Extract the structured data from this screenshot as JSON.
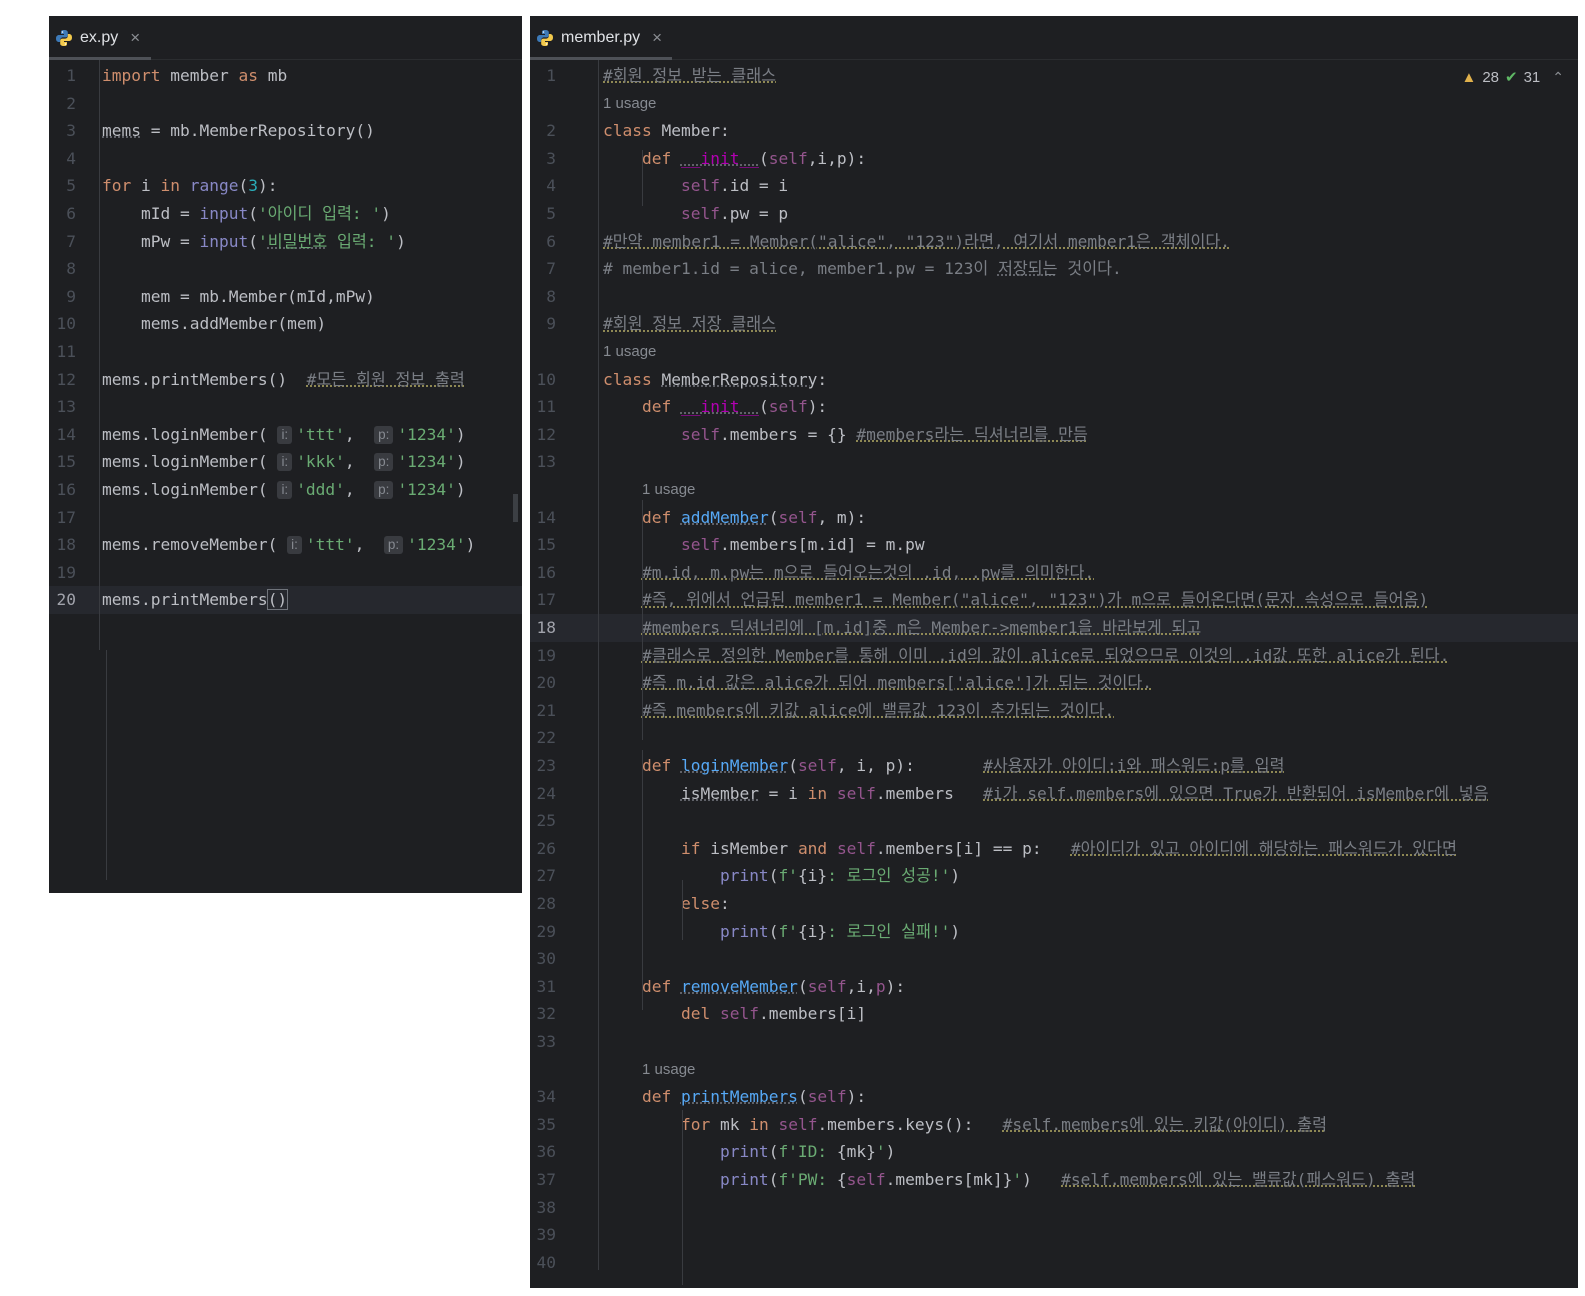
{
  "left_tab": {
    "label": "ex.py",
    "close": "×"
  },
  "right_tab": {
    "label": "member.py",
    "close": "×"
  },
  "inspection": {
    "warnings": "28",
    "ok": "31"
  },
  "usage_label": "1 usage",
  "left_code": [
    {
      "n": "1",
      "html": "<span class='kw'>import</span> member <span class='kw'>as</span> mb"
    },
    {
      "n": "2",
      "html": ""
    },
    {
      "n": "3",
      "html": "<span class='ul'>mems</span> = mb.MemberRepository()"
    },
    {
      "n": "4",
      "html": ""
    },
    {
      "n": "5",
      "html": "<span class='kw'>for</span> i <span class='kw'>in</span> <span class='bi'>range</span>(<span class='num'>3</span>):"
    },
    {
      "n": "6",
      "html": "    mId = <span class='bi'>input</span>(<span class='str'>'아이디 입력: '</span>)"
    },
    {
      "n": "7",
      "html": "    mPw = <span class='bi'>input</span>(<span class='str'>'<span class=\"ul\">비밀번호</span> 입력: '</span>)"
    },
    {
      "n": "8",
      "html": ""
    },
    {
      "n": "9",
      "html": "    mem = mb.Member(mId,mPw)"
    },
    {
      "n": "10",
      "html": "    mems.addMember(mem)"
    },
    {
      "n": "11",
      "html": ""
    },
    {
      "n": "12",
      "html": "mems.printMembers()  <span class='cm'>#모든 회원 정보 출력</span>"
    },
    {
      "n": "13",
      "html": ""
    },
    {
      "n": "14",
      "html": "mems.loginMember( <span class='hint'>i:</span><span class='str'>'ttt'</span>,  <span class='hint'>p:</span><span class='str'>'1234'</span>)"
    },
    {
      "n": "15",
      "html": "mems.loginMember( <span class='hint'>i:</span><span class='str'>'kkk'</span>,  <span class='hint'>p:</span><span class='str'>'1234'</span>)"
    },
    {
      "n": "16",
      "html": "mems.loginMember( <span class='hint'>i:</span><span class='str'>'ddd'</span>,  <span class='hint'>p:</span><span class='str'>'1234'</span>)"
    },
    {
      "n": "17",
      "html": ""
    },
    {
      "n": "18",
      "html": "mems.removeMember( <span class='hint'>i:</span><span class='str'>'ttt'</span>,  <span class='hint'>p:</span><span class='str'>'1234'</span>)"
    },
    {
      "n": "19",
      "html": ""
    },
    {
      "n": "20",
      "html": "mems.printMembers<span class='caret-sel'>()</span>",
      "current": true
    }
  ],
  "right_code": [
    {
      "n": "1",
      "html": "<span class='cm'>#회원 정보 받는 클래스</span>"
    },
    {
      "usage": true,
      "indent": 0
    },
    {
      "n": "2",
      "html": "<span class='kw'>class</span> Member:"
    },
    {
      "n": "3",
      "html": "    <span class='kw'>def</span> <span class='mn ul'>__init__</span>(<span class='slf'>self</span>,i,p):"
    },
    {
      "n": "4",
      "html": "        <span class='slf'>self</span>.id = i"
    },
    {
      "n": "5",
      "html": "        <span class='slf'>self</span>.pw = p"
    },
    {
      "n": "6",
      "html": "<span class='cm'>#만약 member1 = Member(\"alice\", \"123\")라면, 여기서 member1은 객체이다.</span>"
    },
    {
      "n": "7",
      "html": "<span style='color:#7a7e85'># member1.id = alice, member1.pw = 123이 <span class='ul'>저장되는</span> 것이다.</span>"
    },
    {
      "n": "8",
      "html": ""
    },
    {
      "n": "9",
      "html": "<span class='cm'>#회원 정보 저장 클래스</span>"
    },
    {
      "usage": true,
      "indent": 0
    },
    {
      "n": "10",
      "html": "<span class='kw'>class</span> <span class='ul'>MemberRepository</span>:"
    },
    {
      "n": "11",
      "html": "    <span class='kw'>def</span> <span class='mn ul'>__init__</span>(<span class='slf'>self</span>):"
    },
    {
      "n": "12",
      "html": "        <span class='slf'>self</span>.members = {} <span class='cm'>#members라는 딕셔너리를 만듬</span>"
    },
    {
      "n": "13",
      "html": ""
    },
    {
      "usage": true,
      "indent": 4
    },
    {
      "n": "14",
      "html": "    <span class='kw'>def</span> <span class='fn'>addMember</span>(<span class='slf'>self</span>, m):"
    },
    {
      "n": "15",
      "html": "        <span class='slf'>self</span>.members[m.id] = m.pw"
    },
    {
      "n": "16",
      "html": "    <span class='cm'>#m.id, m.pw는 m으로 들어오는것의 .id, .pw를 의미한다.</span>"
    },
    {
      "n": "17",
      "html": "    <span class='cm'>#즉, 위에서 언급된 member1 = Member(\"alice\", \"123\")가 m으로 들어온다면(문자 속성으로 들어옴)</span>"
    },
    {
      "n": "18",
      "html": "    <span class='cm'>#members 딕셔너리에 [m.id]중 m은 Member->member1을 바라보게 되고</span>",
      "current": true
    },
    {
      "n": "19",
      "html": "    <span class='cm'>#클래스로 정의한 Member를 통해 이미 .id의 값이 alice로 되었으므로 이것의 .id값 또한 alice가 된다.</span>"
    },
    {
      "n": "20",
      "html": "    <span class='cm'>#즉 m.id 값은 alice가 되어 members['alice']가 되는 것이다.</span>"
    },
    {
      "n": "21",
      "html": "    <span class='cm'>#즉 members에 키값 alice에 밸류값 123이 추가되는 것이다.</span>"
    },
    {
      "n": "22",
      "html": ""
    },
    {
      "n": "23",
      "html": "    <span class='kw'>def</span> <span class='fn'>loginMember</span>(<span class='slf'>self</span>, i, p):       <span class='cm'>#사용자가 아이디:i와 패스워드:p를 입력</span>"
    },
    {
      "n": "24",
      "html": "        <span class='ul'>isMember</span> = i <span class='kw'>in</span> <span class='slf'>self</span>.members   <span class='cm'>#i가 self.members에 있으면 True가 반환되어 isMember에 넣음</span>"
    },
    {
      "n": "25",
      "html": ""
    },
    {
      "n": "26",
      "html": "        <span class='kw'>if</span> isMember <span class='kw'>and</span> <span class='slf'>self</span>.members[i] == p:   <span class='cm'>#아이디가 있고 아이디에 해당하는 패스워드가 있다면</span>"
    },
    {
      "n": "27",
      "html": "            <span class='bi'>print</span>(<span class='str'>f'</span>{i}<span class='str'>: 로그인 성공!'</span>)"
    },
    {
      "n": "28",
      "html": "        <span class='kw'>else</span>:"
    },
    {
      "n": "29",
      "html": "            <span class='bi'>print</span>(<span class='str'>f'</span>{i}<span class='str'>: 로그인 실패!'</span>)"
    },
    {
      "n": "30",
      "html": ""
    },
    {
      "n": "31",
      "html": "    <span class='kw'>def</span> <span class='fn'>removeMember</span>(<span class='slf'>self</span>,i,<span class='slf'>p</span>):"
    },
    {
      "n": "32",
      "html": "        <span class='kw'>del</span> <span class='slf'>self</span>.members[i]"
    },
    {
      "n": "33",
      "html": ""
    },
    {
      "usage": true,
      "indent": 4
    },
    {
      "n": "34",
      "html": "    <span class='kw'>def</span> <span class='fn'>printMembers</span>(<span class='slf'>self</span>):"
    },
    {
      "n": "35",
      "html": "        <span class='kw'>for</span> mk <span class='kw'>in</span> <span class='slf'>self</span>.members.keys():   <span class='cm'>#self.members에 있는 키값(아이디) 출력</span>"
    },
    {
      "n": "36",
      "html": "            <span class='bi'>print</span>(<span class='str'>f'ID: </span>{mk}<span class='str'>'</span>)"
    },
    {
      "n": "37",
      "html": "            <span class='bi'>print</span>(<span class='str'>f'PW: </span>{<span class='slf'>self</span>.members[mk]}<span class='str'>'</span>)   <span class='cm'>#self.members에 있는 밸류값(패스워드) 출력</span>"
    },
    {
      "n": "38",
      "html": ""
    },
    {
      "n": "39",
      "html": ""
    },
    {
      "n": "40",
      "html": ""
    }
  ]
}
